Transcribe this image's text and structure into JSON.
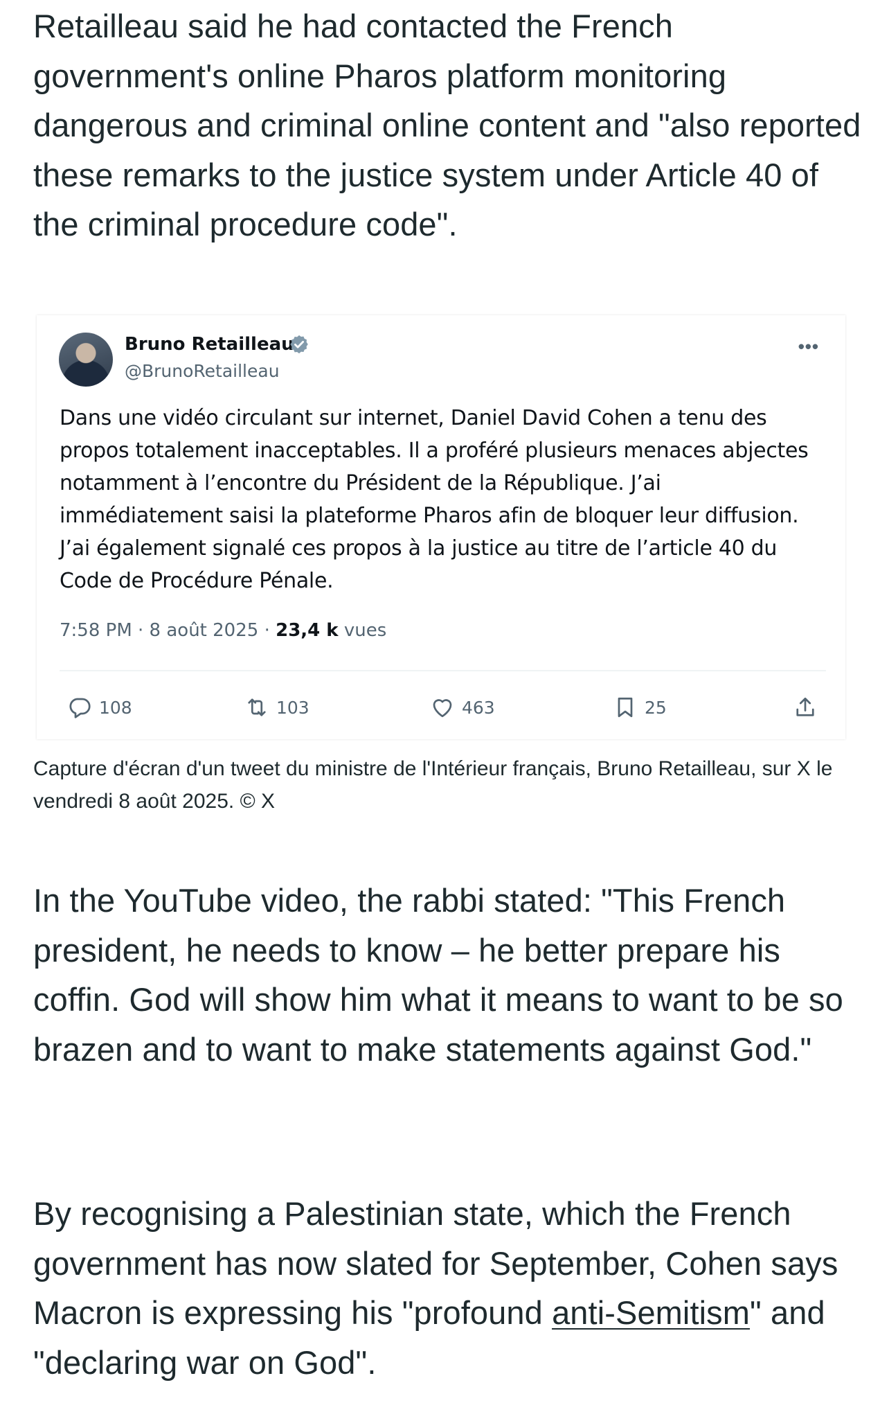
{
  "article": {
    "para1": "Retailleau said he had contacted the French government's online Pharos platform monitoring dangerous and criminal online content and \"also reported these remarks to the justice system under Article 40 of the criminal procedure code\".",
    "para2": "In the YouTube video, the rabbi stated: \"This French president, he needs to know – he better prepare his coffin. God will show him what it means to want to be so brazen and to want to make statements against God.\"",
    "para3_before": "By recognising a Palestinian state, which the French government has now slated for September, Cohen says Macron is expressing his \"profound ",
    "para3_link": "anti-Semitism",
    "para3_after": "\" and \"declaring war on God\"."
  },
  "tweet": {
    "name": "Bruno Retailleau",
    "handle": "@BrunoRetailleau",
    "text": "Dans une vidéo circulant sur internet, Daniel David Cohen a tenu des propos totalement inacceptables. Il a proféré plusieurs menaces abjectes notamment à l’encontre du Président de la République. J’ai immédiatement saisi la plateforme Pharos afin de bloquer leur diffusion. J’ai également signalé ces propos à la justice au titre de l’article 40 du Code de Procédure Pénale.",
    "time": "7:58 PM · 8 août 2025 · ",
    "views_count": "23,4 k",
    "views_label": " vues",
    "replies": "108",
    "retweets": "103",
    "likes": "463",
    "bookmarks": "25",
    "more_icon": "ellipsis-icon",
    "verified_color": "#829aab"
  },
  "caption": "Capture d'écran d'un tweet du ministre de l'Intérieur français, Bruno Retailleau, sur X le vendredi 8 août 2025. © X"
}
